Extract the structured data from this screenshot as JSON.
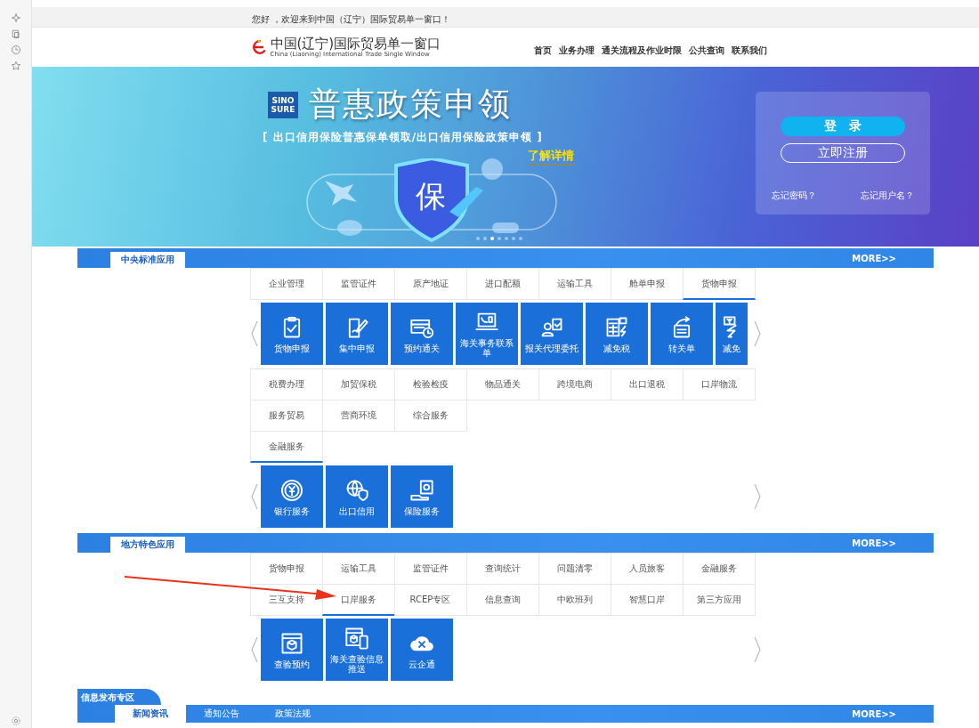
{
  "greeting": "您好 ，欢迎来到中国（辽宁）国际贸易单一窗口！",
  "header": {
    "title": "中国(辽宁)国际贸易单一窗口",
    "subtitle": "China (Liaoning) International Trade Single Window",
    "nav": [
      "首页",
      "业务办理",
      "通关流程及作业时限",
      "公共查询",
      "联系我们"
    ]
  },
  "banner": {
    "logo_lines": [
      "SINO",
      "SURE"
    ],
    "headline": "普惠政策申领",
    "subtitle": "[ 出口信用保险普惠保单领取/出口信用保险政策申领 ]",
    "link": "了解详情",
    "shield_text": "保",
    "dots": [
      {
        "selected": false
      },
      {
        "selected": false
      },
      {
        "selected": true
      },
      {
        "selected": false
      },
      {
        "selected": false
      },
      {
        "selected": false
      },
      {
        "selected": false
      }
    ],
    "login": {
      "login": "登　录",
      "register": "立即注册",
      "forgot_password": "忘记密码？",
      "forgot_username": "忘记用户名？"
    }
  },
  "sections": [
    {
      "title": "中央标准应用",
      "more": "MORE>>",
      "groups": [
        {
          "rows": [
            [
              {
                "label": "企业管理",
                "selected": false
              },
              {
                "label": "监管证件",
                "selected": false
              },
              {
                "label": "原产地证",
                "selected": false
              },
              {
                "label": "进口配额",
                "selected": false
              },
              {
                "label": "运输工具",
                "selected": false
              },
              {
                "label": "舱单申报",
                "selected": false
              },
              {
                "label": "货物申报",
                "selected": true
              }
            ]
          ],
          "tiles": [
            {
              "label": "货物申报",
              "kind": "clipboard"
            },
            {
              "label": "集中申报",
              "kind": "pen"
            },
            {
              "label": "预约通关",
              "kind": "schedule"
            },
            {
              "label": "海关事务联系单",
              "kind": "laptop"
            },
            {
              "label": "报关代理委托",
              "kind": "agent"
            },
            {
              "label": "减免税",
              "kind": "calculator"
            },
            {
              "label": "转关单",
              "kind": "forward"
            },
            {
              "label": "减免",
              "kind": "tax",
              "cut": true
            }
          ]
        },
        {
          "rows": [
            [
              {
                "label": "税费办理",
                "selected": false
              },
              {
                "label": "加贸保税",
                "selected": false
              },
              {
                "label": "检验检疫",
                "selected": false
              },
              {
                "label": "物品通关",
                "selected": false
              },
              {
                "label": "跨境电商",
                "selected": false
              },
              {
                "label": "出口退税",
                "selected": false
              },
              {
                "label": "口岸物流",
                "selected": false
              }
            ],
            [
              {
                "label": "服务贸易",
                "selected": false
              },
              {
                "label": "营商环境",
                "selected": false
              },
              {
                "label": "综合服务",
                "selected": false
              }
            ],
            [
              {
                "label": "金融服务",
                "selected": true
              }
            ]
          ],
          "tiles": [
            {
              "label": "银行服务",
              "kind": "coin"
            },
            {
              "label": "出口信用",
              "kind": "globe"
            },
            {
              "label": "保险服务",
              "kind": "safe"
            }
          ]
        }
      ]
    },
    {
      "title": "地方特色应用",
      "more": "MORE>>",
      "groups": [
        {
          "rows": [
            [
              {
                "label": "货物申报",
                "selected": false
              },
              {
                "label": "运输工具",
                "selected": false
              },
              {
                "label": "监管证件",
                "selected": false
              },
              {
                "label": "查询统计",
                "selected": false
              },
              {
                "label": "问题清零",
                "selected": false
              },
              {
                "label": "人员旅客",
                "selected": false
              },
              {
                "label": "金融服务",
                "selected": false
              }
            ],
            [
              {
                "label": "三互支持",
                "selected": false
              },
              {
                "label": "口岸服务",
                "selected": true
              },
              {
                "label": "RCEP专区",
                "selected": false
              },
              {
                "label": "信息查询",
                "selected": false
              },
              {
                "label": "中欧班列",
                "selected": false
              },
              {
                "label": "智慧口岸",
                "selected": false
              },
              {
                "label": "第三方应用",
                "selected": false
              }
            ]
          ],
          "tiles": [
            {
              "label": "查验预约",
              "kind": "box"
            },
            {
              "label": "海关查验信息推送",
              "kind": "boxphone"
            },
            {
              "label": "云企通",
              "kind": "cloud"
            }
          ]
        }
      ]
    }
  ],
  "news": {
    "title": "信息发布专区",
    "more": "MORE>>",
    "tabs": [
      {
        "label": "新闻资讯",
        "selected": true
      },
      {
        "label": "通知公告",
        "selected": false
      },
      {
        "label": "政策法规",
        "selected": false
      }
    ]
  }
}
